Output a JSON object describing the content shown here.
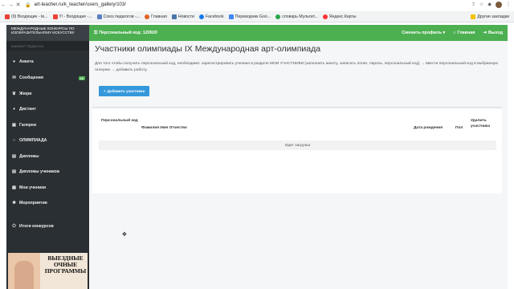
{
  "browser": {
    "url": "art-teacher.ru/k_teacher/users_gallery/103/",
    "bookmarks": [
      {
        "label": "(9) Входящие - te...",
        "color": "#ea4335"
      },
      {
        "label": "!!! - Входящие -...",
        "color": "#ea4335"
      },
      {
        "label": "Союз педагогов -...",
        "color": "#5b7fbf"
      },
      {
        "label": "Главная",
        "color": "#e06020"
      },
      {
        "label": "Новости",
        "color": "#4a76a8"
      },
      {
        "label": "Facebook",
        "color": "#1877f2"
      },
      {
        "label": "Переводчик Goo...",
        "color": "#4285f4"
      },
      {
        "label": "словарь Мультит...",
        "color": "#2aa84a"
      },
      {
        "label": "Яндекс.Карты",
        "color": "#ff3333"
      }
    ],
    "other_bookmarks": "Другие закладки"
  },
  "sidebar": {
    "brand": "Международные конкурсы по изобразительному искусству",
    "subtitle": "Кабинет педагога",
    "items": [
      {
        "label": "Анкета",
        "icon": "user-icon"
      },
      {
        "label": "Сообщения",
        "icon": "envelope-icon",
        "badge": "42"
      },
      {
        "label": "Жюри",
        "icon": "trophy-icon"
      },
      {
        "label": "Дистант",
        "icon": "bulb-icon"
      },
      {
        "label": "Галереи",
        "icon": "image-icon"
      },
      {
        "label": "ОЛИМПИАДА",
        "icon": "circle-icon"
      },
      {
        "label": "Дипломы",
        "icon": "document-icon"
      },
      {
        "label": "Дипломы учеников",
        "icon": "document-icon"
      },
      {
        "label": "Мои ученики",
        "icon": "users-icon"
      },
      {
        "label": "Мероприятия",
        "icon": "gear-icon"
      },
      {
        "label": "Итоги конкурсов",
        "icon": "power-icon"
      }
    ],
    "banner_text": "Выездные очные программы"
  },
  "topbar": {
    "personal_code": "Персональный код: 120920",
    "change_profile": "Сменить профиль",
    "home": "Главная",
    "logout": "Выход"
  },
  "main": {
    "title": "Участники олимпиады IX Международная арт-олимпиада",
    "hint": "Для того чтобы получить персональный код, необходимо: зарегистрировать ученика в разделе МОИ УЧАСТНИКИ (заполнить анкету, записать логин, пароль, персональный код) → ввести персональный код в выбранную галерею → добавить работу.",
    "add_button": "Добавить участника",
    "columns": {
      "code": "Персональный код",
      "name": "Фамилия Имя Отчество",
      "birth": "Дата рождения",
      "sex": "Пол",
      "delete": "Удалить участника"
    },
    "loading": "Идет загрузка"
  }
}
